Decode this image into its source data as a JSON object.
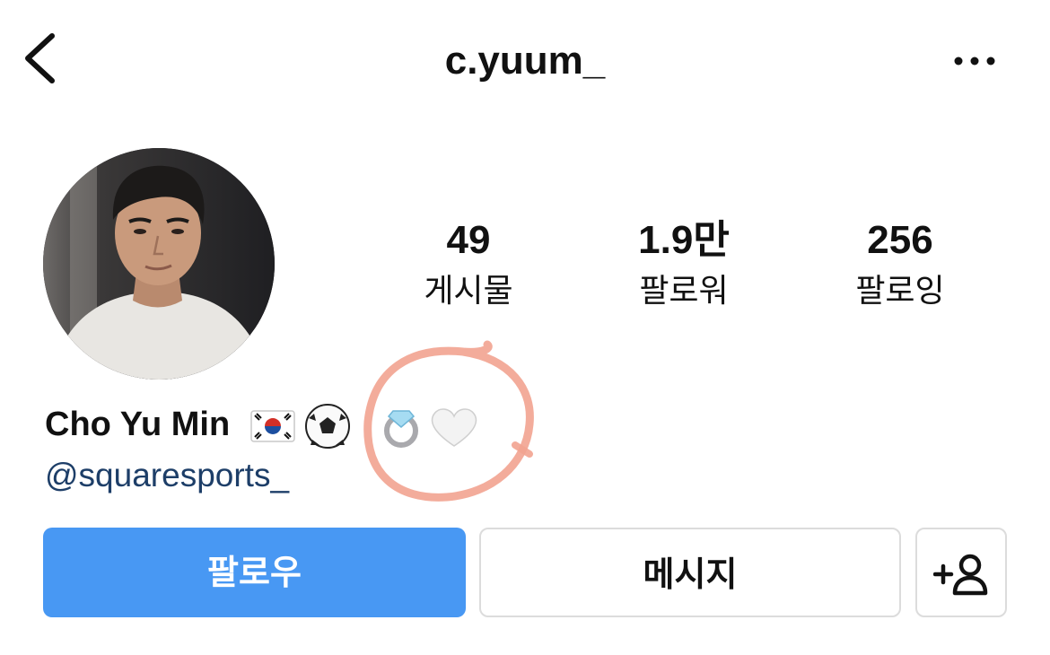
{
  "header": {
    "username": "c.yuum_",
    "back_icon": "chevron-left-icon",
    "more_icon": "more-horizontal-icon"
  },
  "profile": {
    "stats": [
      {
        "value": "49",
        "label": "게시물"
      },
      {
        "value": "1.9만",
        "label": "팔로워"
      },
      {
        "value": "256",
        "label": "팔로잉"
      }
    ],
    "display_name": "Cho Yu Min",
    "name_emojis": [
      "korea-flag-icon",
      "soccer-ball-icon",
      "ring-icon",
      "white-heart-icon"
    ],
    "link": "@squaresports_"
  },
  "actions": {
    "follow_label": "팔로우",
    "message_label": "메시지",
    "add_user_icon": "add-user-icon"
  },
  "colors": {
    "follow_button": "#4898f3",
    "link_text": "#1d3e68",
    "highlight_circle": "#f2a390"
  }
}
